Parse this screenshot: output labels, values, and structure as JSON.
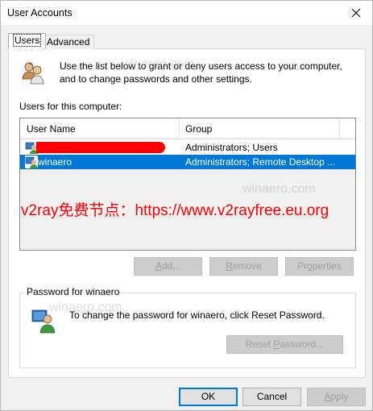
{
  "window": {
    "title": "User Accounts"
  },
  "tabs": [
    {
      "label": "Users"
    },
    {
      "label": "Advanced"
    }
  ],
  "users_panel": {
    "intro": "Use the list below to grant or deny users access to your computer, and to change passwords and other settings.",
    "list_label": "Users for this computer:",
    "columns": {
      "name": "User Name",
      "group": "Group"
    },
    "rows": [
      {
        "name": "",
        "group": "Administrators; Users"
      },
      {
        "name": "winaero",
        "group": "Administrators; Remote Desktop ..."
      }
    ],
    "buttons": {
      "add": "Add...",
      "remove": "Remove",
      "properties": "Properties"
    }
  },
  "password_group": {
    "title": "Password for winaero",
    "text": "To change the password for winaero, click Reset Password.",
    "reset_button": "Reset Password..."
  },
  "watermark": {
    "text": "v2ray免费节点：https://www.v2rayfree.eu.org",
    "faint": "winaero.com"
  },
  "footer": {
    "ok": "OK",
    "cancel": "Cancel",
    "apply": "Apply"
  },
  "colors": {
    "selection": "#0078d7",
    "redaction": "#ff0000",
    "watermark": "#ff0000"
  },
  "icons": {
    "close": "close-icon",
    "users": "users-group-icon",
    "user": "user-icon",
    "password": "password-user-icon"
  }
}
